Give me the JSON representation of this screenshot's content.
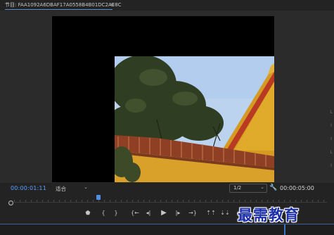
{
  "panel": {
    "tab_label": "节目: FAA1092A6DBAF17A0558B4B01DC2AE8C",
    "menu_glyph": "≡",
    "side_glyphs": [
      "L",
      "I",
      "I",
      "L",
      "I"
    ]
  },
  "timecode": {
    "current": "00:00:01:11",
    "duration": "00:00:05:00"
  },
  "fit": {
    "value": "适合",
    "chevron": "⌄"
  },
  "resolution": {
    "value": "1/2",
    "chevron": "⌄"
  },
  "settings_glyph": "🔧",
  "playhead_position": 0.27,
  "controls": {
    "add_marker": "⬟",
    "mark_in": "{",
    "mark_out": "}",
    "go_to_in": "{←",
    "step_back": "◂|",
    "play": "▶",
    "step_forward": "|▸",
    "go_to_out": "→}",
    "lift": "⇡⇡",
    "extract": "⇣⇣",
    "export_frame": "◉"
  },
  "watermark": "最需教育",
  "colors": {
    "accent_blue": "#5aa0ff",
    "playhead": "#4f8fe6",
    "watermark": "#1c2ea8",
    "sky": "#bcd3ef",
    "wall": "#d9a02a",
    "roof": "#9e4a2a"
  }
}
